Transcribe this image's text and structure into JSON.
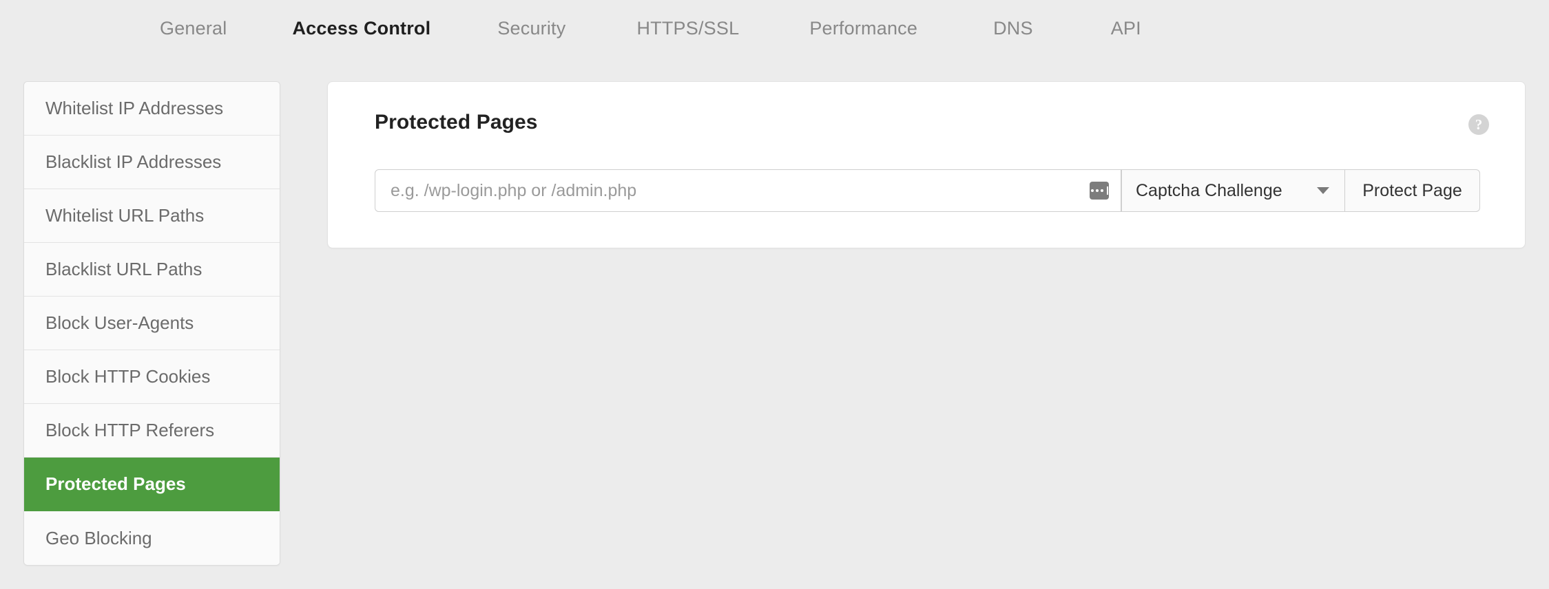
{
  "topnav": {
    "items": [
      {
        "label": "General",
        "active": false
      },
      {
        "label": "Access Control",
        "active": true
      },
      {
        "label": "Security",
        "active": false
      },
      {
        "label": "HTTPS/SSL",
        "active": false
      },
      {
        "label": "Performance",
        "active": false
      },
      {
        "label": "DNS",
        "active": false
      },
      {
        "label": "API",
        "active": false
      }
    ]
  },
  "sidebar": {
    "items": [
      {
        "label": "Whitelist IP Addresses",
        "active": false
      },
      {
        "label": "Blacklist IP Addresses",
        "active": false
      },
      {
        "label": "Whitelist URL Paths",
        "active": false
      },
      {
        "label": "Blacklist URL Paths",
        "active": false
      },
      {
        "label": "Block User-Agents",
        "active": false
      },
      {
        "label": "Block HTTP Cookies",
        "active": false
      },
      {
        "label": "Block HTTP Referers",
        "active": false
      },
      {
        "label": "Protected Pages",
        "active": true
      },
      {
        "label": "Geo Blocking",
        "active": false
      }
    ]
  },
  "panel": {
    "title": "Protected Pages",
    "help_icon_label": "?",
    "path_field": {
      "value": "",
      "placeholder": "e.g. /wp-login.php or /admin.php"
    },
    "action_select": {
      "selected": "Captcha Challenge",
      "options": [
        "Captcha Challenge"
      ]
    },
    "protect_button_label": "Protect Page"
  },
  "colors": {
    "page_background": "#ececec",
    "panel_background": "#ffffff",
    "sidebar_background": "#fafafa",
    "active_sidebar_green": "#4d9c3f",
    "muted_text": "#888888",
    "body_text": "#6b6b6b"
  }
}
